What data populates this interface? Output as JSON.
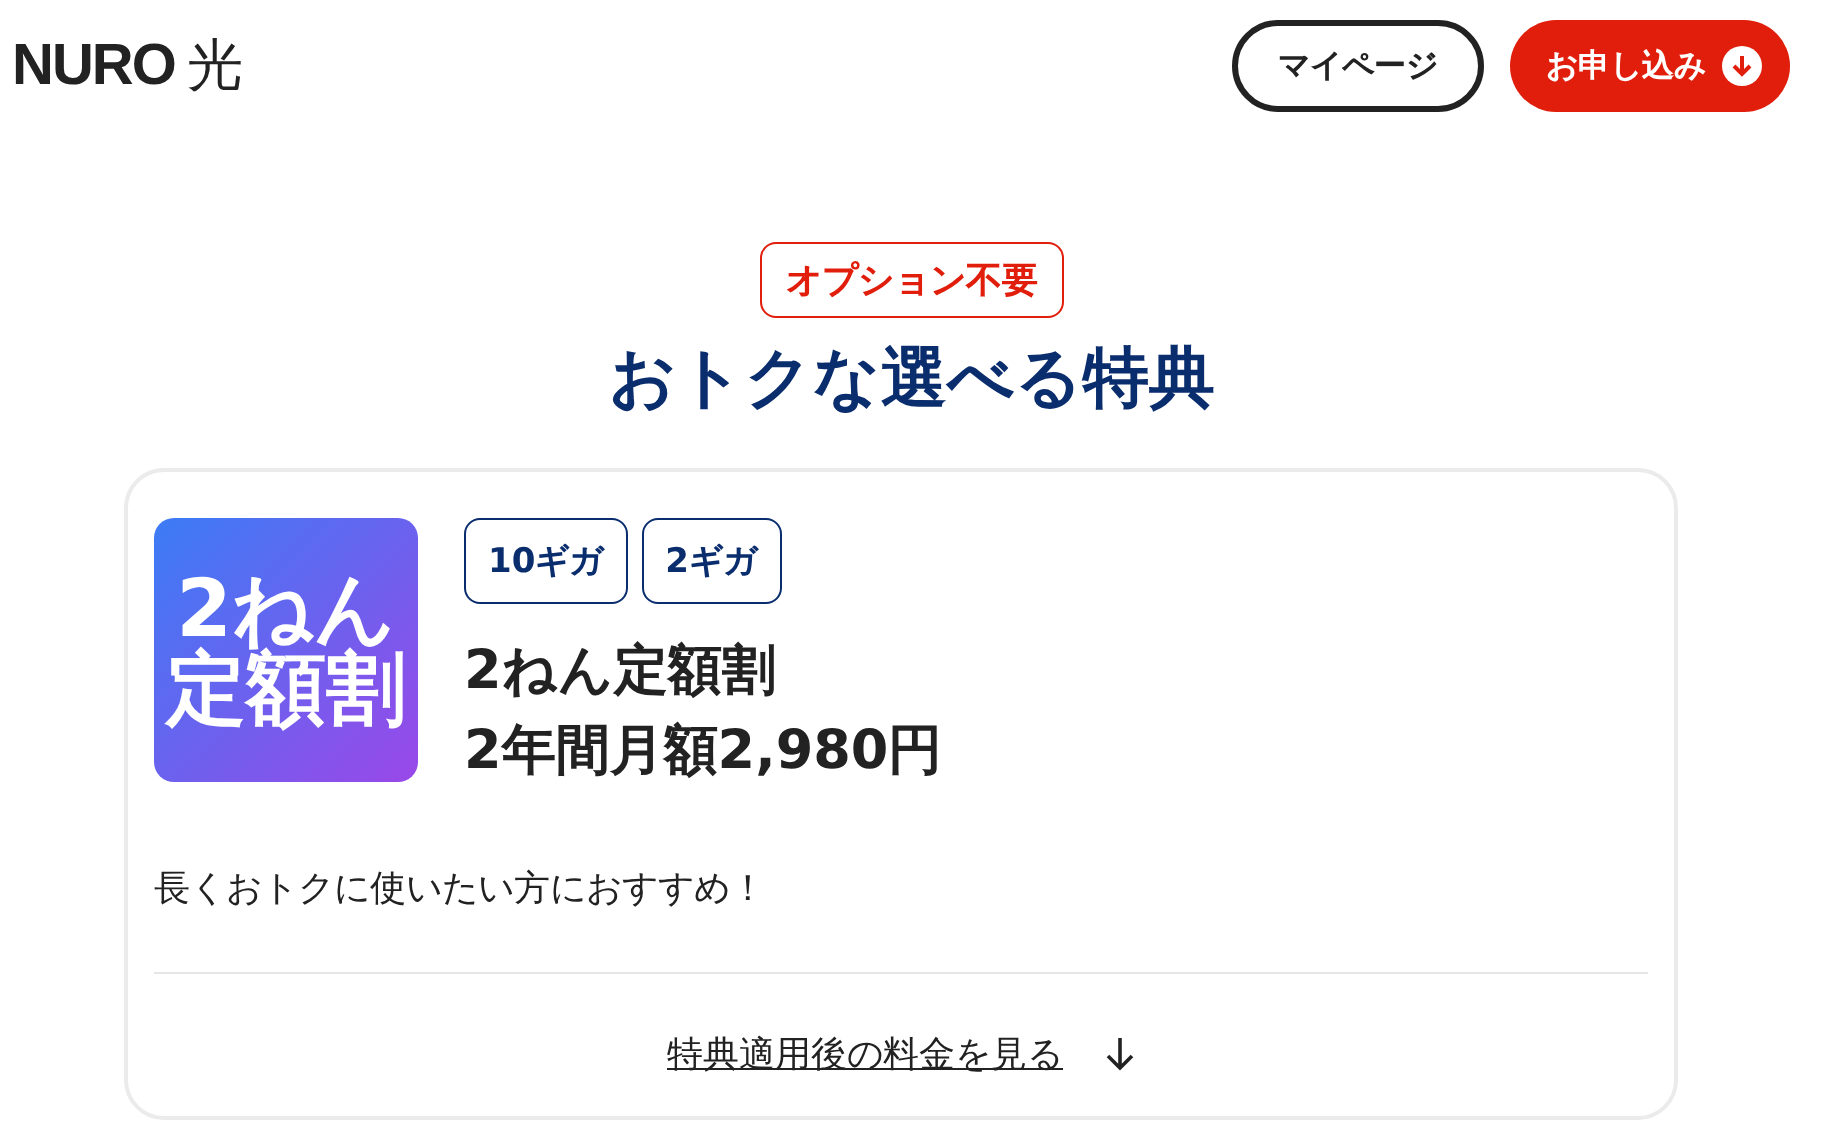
{
  "header": {
    "logo": {
      "brand": "NURO",
      "suffix": "光"
    },
    "buttons": [
      {
        "label": "マイページ",
        "kind": "outline"
      },
      {
        "label": "お申し込み",
        "kind": "primary"
      }
    ]
  },
  "section": {
    "badge": "オプション不要",
    "title": "おトクな選べる特典"
  },
  "card": {
    "icon_lines": [
      "2ねん",
      "定額割"
    ],
    "tags": [
      "10ギガ",
      "2ギガ"
    ],
    "title_lines": [
      "2ねん定額割",
      "2年間月額2,980円"
    ],
    "description": "長くおトクに使いたい方におすすめ！",
    "link": "特典適用後の料金を見る"
  }
}
